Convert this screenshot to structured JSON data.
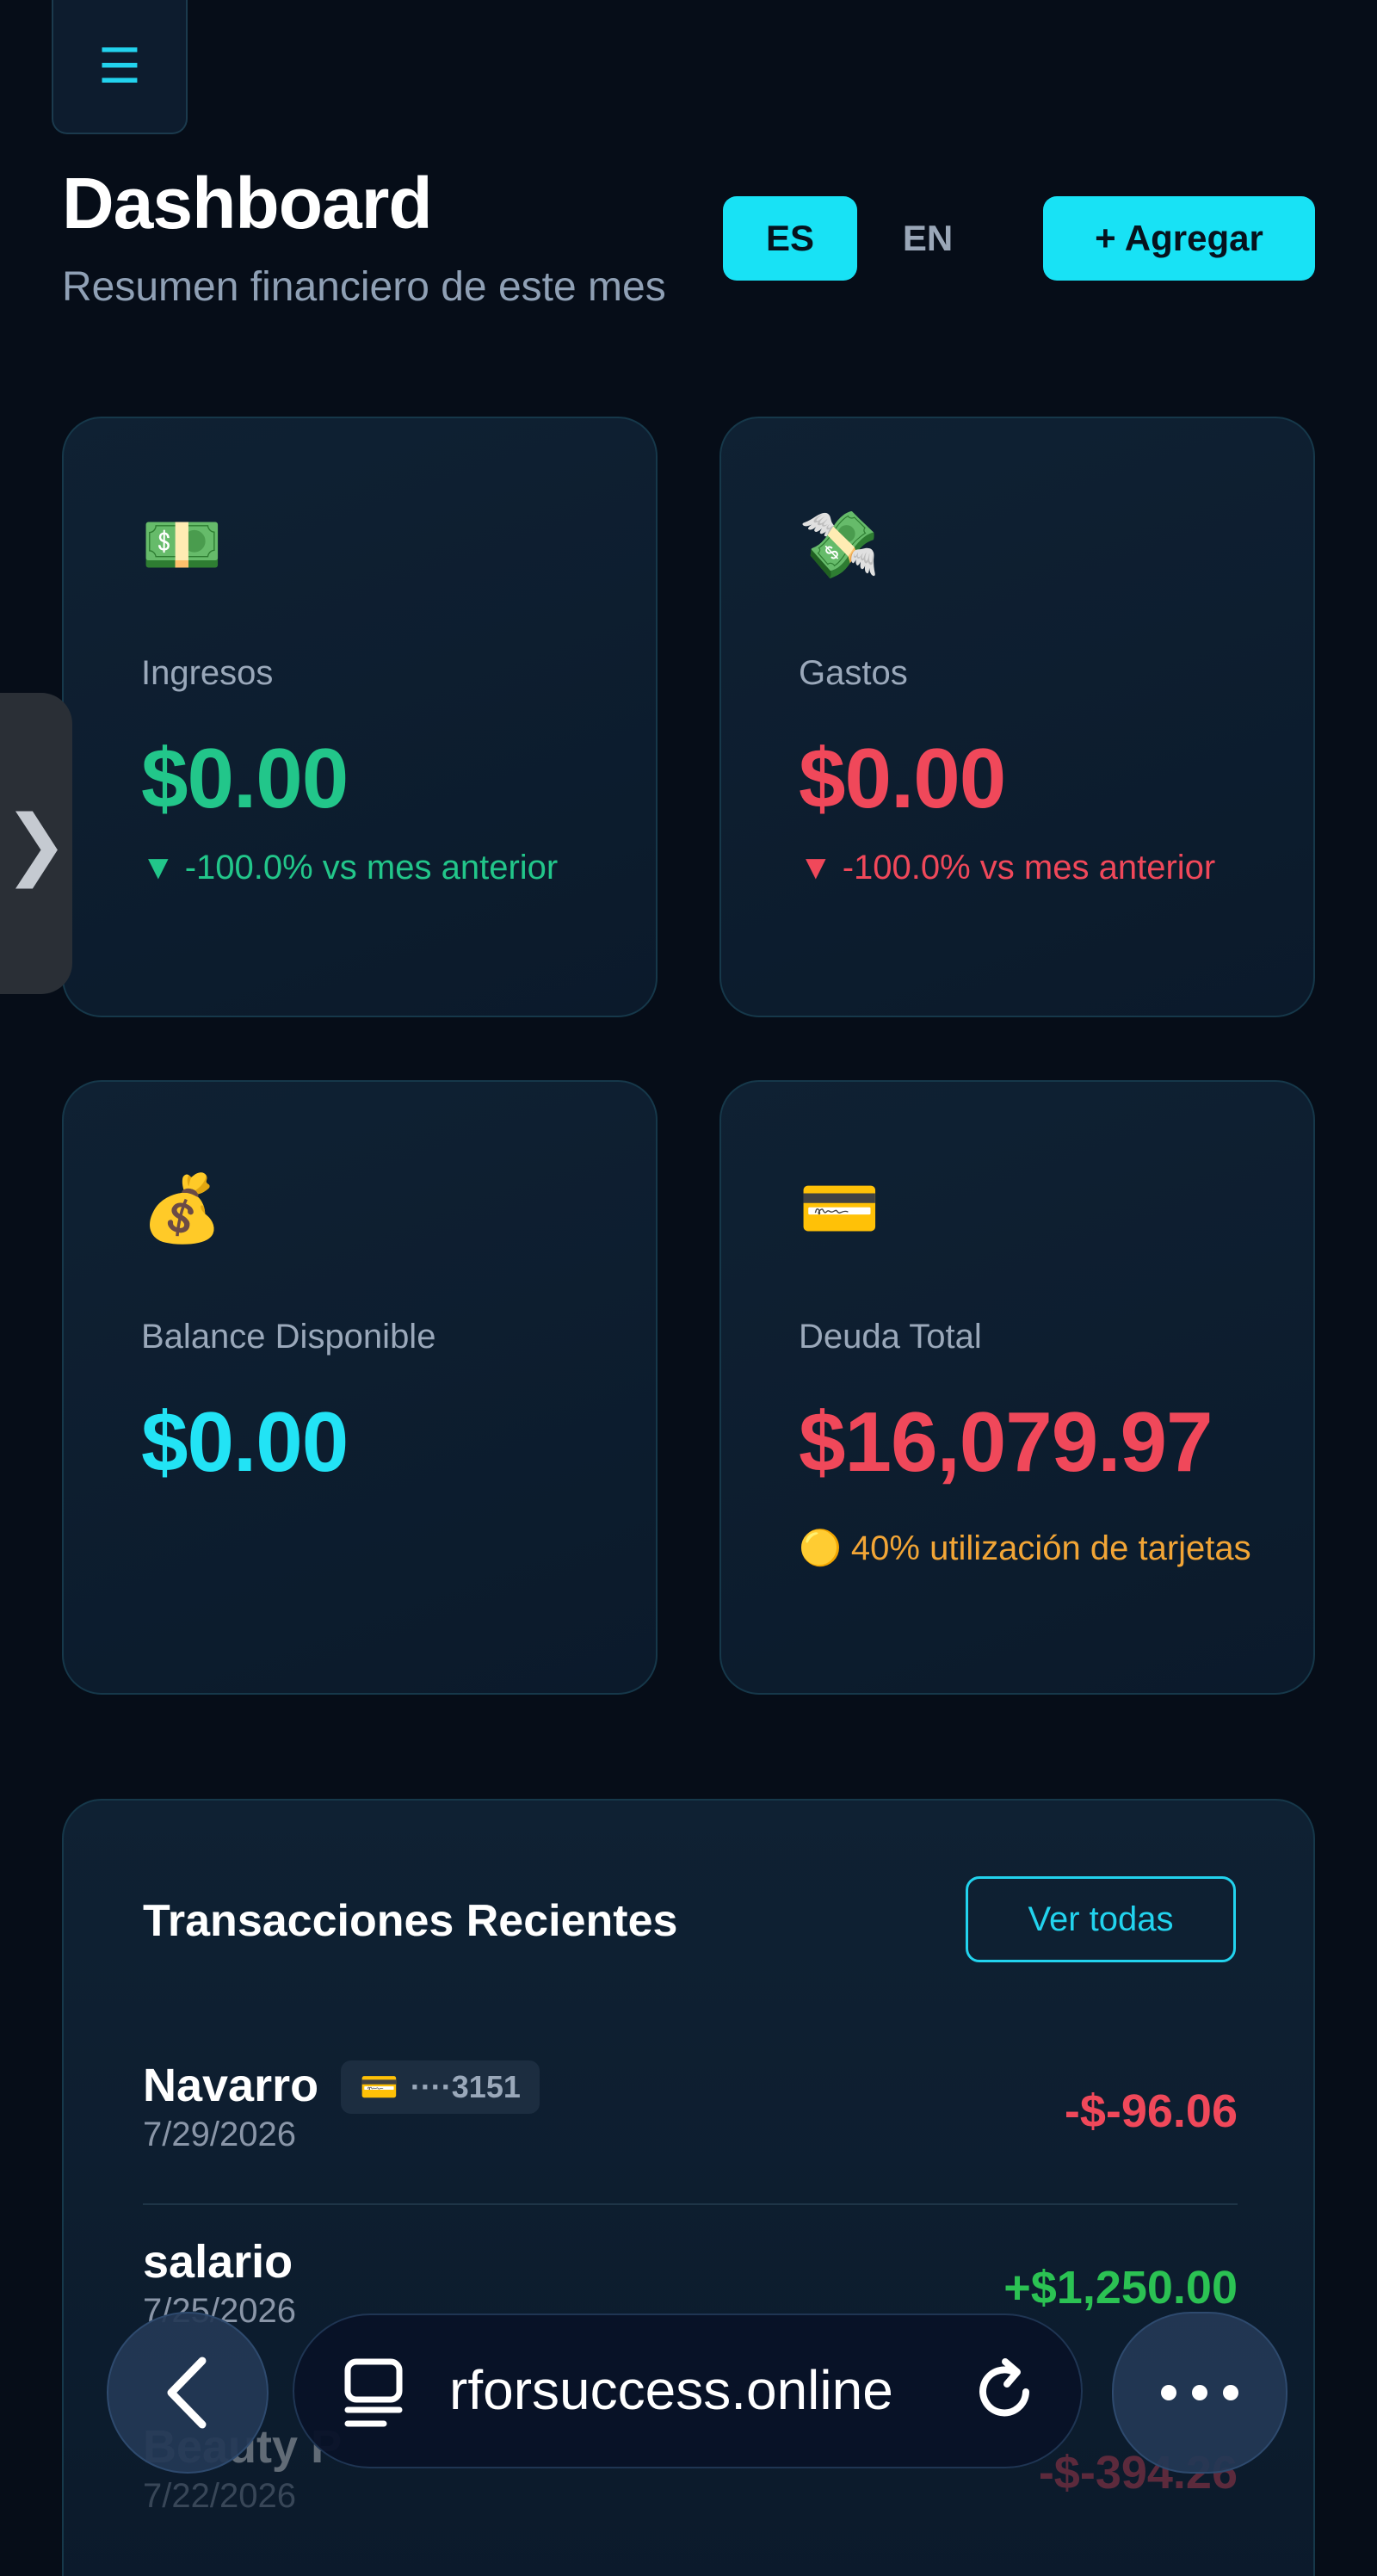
{
  "header": {
    "menu_icon": "☰",
    "title": "Dashboard",
    "subtitle": "Resumen financiero de este mes",
    "lang_es": "ES",
    "lang_en": "EN",
    "add_label": "+ Agregar"
  },
  "side_tab": {
    "chevron": "❯"
  },
  "cards": {
    "income": {
      "emoji": "💵",
      "label": "Ingresos",
      "value": "$0.00",
      "delta": "▼ -100.0% vs mes anterior"
    },
    "expense": {
      "emoji": "💸",
      "label": "Gastos",
      "value": "$0.00",
      "delta": "▼ -100.0% vs mes anterior"
    },
    "balance": {
      "emoji": "💰",
      "label": "Balance Disponible",
      "value": "$0.00"
    },
    "debt": {
      "emoji": "💳",
      "label": "Deuda Total",
      "value": "$16,079.97",
      "note": "🟡 40% utilización de tarjetas"
    }
  },
  "transactions": {
    "title": "Transacciones Recientes",
    "view_all": "Ver todas",
    "rows": [
      {
        "name": "Navarro",
        "card_icon": "💳",
        "card_last4": "····3151",
        "date": "7/29/2026",
        "amount": "-$-96.06"
      },
      {
        "name": "salario",
        "date": "7/25/2026",
        "amount": "+$1,250.00"
      },
      {
        "name": "Beauty P",
        "card_icon": "",
        "card_last4": "",
        "date": "7/22/2026",
        "amount": "-$-394.26"
      }
    ]
  },
  "browser": {
    "url": "rforsuccess.online"
  },
  "colors": {
    "accent": "#18e2f5",
    "positive": "#22c68a",
    "negative": "#f0485a",
    "warning": "#f2a536",
    "background": "#060d18"
  }
}
